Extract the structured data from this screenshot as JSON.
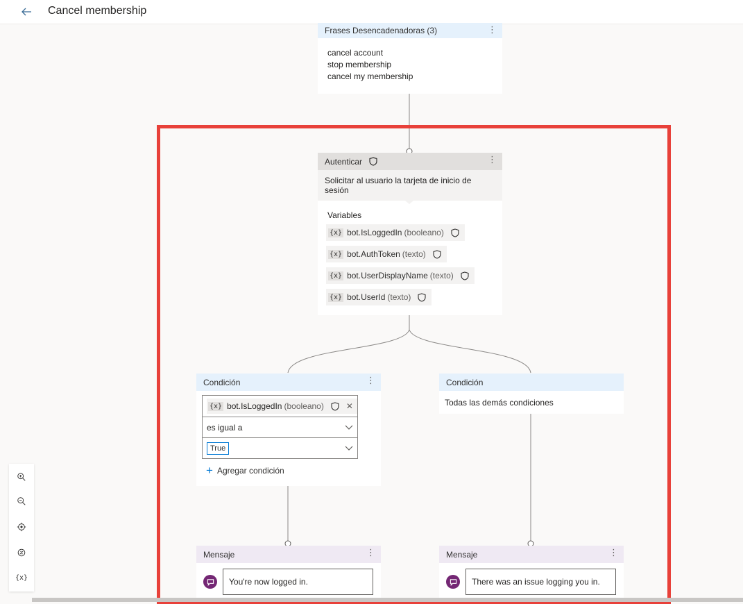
{
  "header": {
    "title": "Cancel membership",
    "back_icon": "arrow-left-icon"
  },
  "trigger": {
    "title": "Frases Desencadenadoras (3)",
    "phrases": [
      "cancel account",
      "stop membership",
      "cancel my membership"
    ]
  },
  "authenticate": {
    "title": "Autenticar",
    "prompt": "Solicitar al usuario la tarjeta de inicio de sesión",
    "variables_title": "Variables",
    "variables": [
      {
        "name": "bot.IsLoggedIn",
        "type": "(booleano)"
      },
      {
        "name": "bot.AuthToken",
        "type": "(texto)"
      },
      {
        "name": "bot.UserDisplayName",
        "type": "(texto)"
      },
      {
        "name": "bot.UserId",
        "type": "(texto)"
      }
    ],
    "var_icon": "{x}"
  },
  "condition_left": {
    "title": "Condición",
    "variable": "bot.IsLoggedIn",
    "variable_type": "(booleano)",
    "operator": "es igual a",
    "value": "True",
    "add_label": "Agregar condición"
  },
  "condition_right": {
    "title": "Condición",
    "text": "Todas las demás condiciones"
  },
  "message_left": {
    "title": "Mensaje",
    "text": "You're now logged in."
  },
  "message_right": {
    "title": "Mensaje",
    "text": "There was an issue logging you in."
  },
  "zoom_panel": {
    "icons": [
      "zoom-in-icon",
      "zoom-out-icon",
      "recenter-icon",
      "reset-zoom-icon",
      "variables-icon"
    ],
    "variables_label": "{x}"
  },
  "colors": {
    "highlight": "#e8413a",
    "header_blue": "#e5f1fc",
    "header_gray": "#e1dfdd",
    "header_purple": "#efe9f3",
    "accent": "#0078d4",
    "message_icon": "#742774"
  }
}
